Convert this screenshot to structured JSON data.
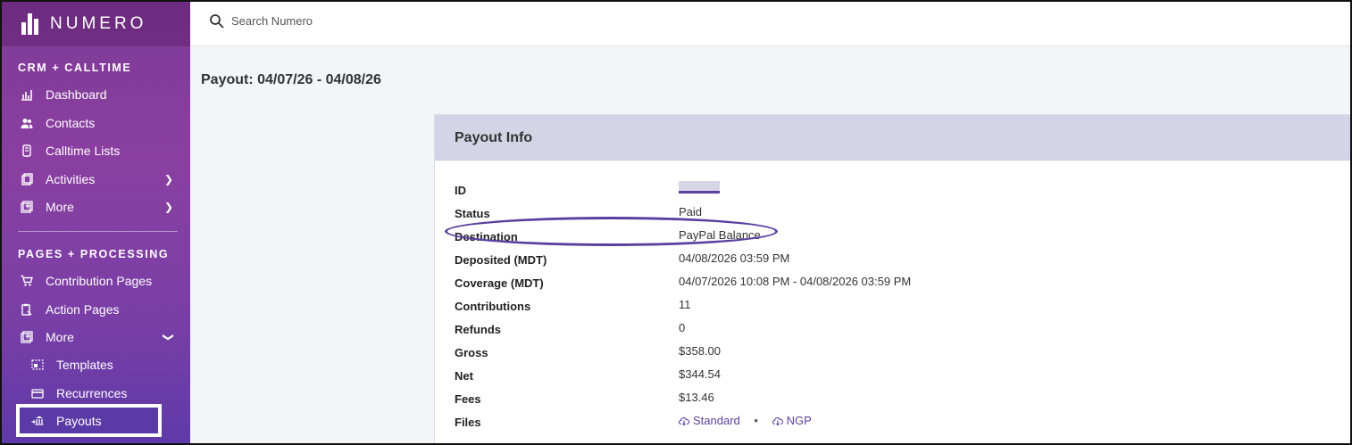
{
  "app": {
    "name": "NUMERO"
  },
  "search": {
    "placeholder": "Search Numero"
  },
  "sidebar": {
    "section1": "CRM + CALLTIME",
    "items1": [
      {
        "label": "Dashboard",
        "icon": "chart-icon"
      },
      {
        "label": "Contacts",
        "icon": "people-icon"
      },
      {
        "label": "Calltime Lists",
        "icon": "phone-list-icon"
      },
      {
        "label": "Activities",
        "icon": "clipboard-icon"
      },
      {
        "label": "More",
        "icon": "add-box-icon"
      }
    ],
    "section2": "PAGES + PROCESSING",
    "items2": [
      {
        "label": "Contribution Pages",
        "icon": "cart-icon"
      },
      {
        "label": "Action Pages",
        "icon": "action-page-icon"
      },
      {
        "label": "More",
        "icon": "add-box-icon"
      }
    ],
    "subitems": [
      {
        "label": "Templates",
        "icon": "template-icon"
      },
      {
        "label": "Recurrences",
        "icon": "card-icon"
      },
      {
        "label": "Payouts",
        "icon": "bank-icon"
      }
    ]
  },
  "page": {
    "title": "Payout: 04/07/26 - 04/08/26"
  },
  "card": {
    "title": "Payout Info",
    "rows": [
      {
        "label": "ID",
        "value": ""
      },
      {
        "label": "Status",
        "value": "Paid"
      },
      {
        "label": "Destination",
        "value": "PayPal Balance"
      },
      {
        "label": "Deposited (MDT)",
        "value": "04/08/2026 03:59 PM"
      },
      {
        "label": "Coverage (MDT)",
        "value": "04/07/2026 10:08 PM - 04/08/2026 03:59 PM"
      },
      {
        "label": "Contributions",
        "value": "11"
      },
      {
        "label": "Refunds",
        "value": "0"
      },
      {
        "label": "Gross",
        "value": "$358.00"
      },
      {
        "label": "Net",
        "value": "$344.54"
      },
      {
        "label": "Fees",
        "value": "$13.46"
      },
      {
        "label": "Files",
        "value": ""
      }
    ],
    "files": {
      "standard": "Standard",
      "ngp": "NGP",
      "separator": "•"
    }
  },
  "colors": {
    "accent": "#5b3fa0",
    "sidebar": "#7e3a96"
  }
}
